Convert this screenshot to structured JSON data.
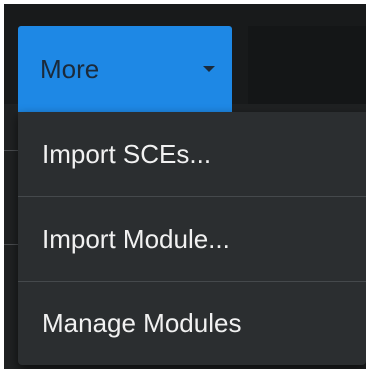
{
  "more_button": {
    "label": "More",
    "icon": "caret-down-icon",
    "color": "#1e88e5"
  },
  "menu": {
    "items": [
      {
        "label": "Import SCEs..."
      },
      {
        "label": "Import Module..."
      },
      {
        "label": "Manage Modules"
      }
    ]
  }
}
